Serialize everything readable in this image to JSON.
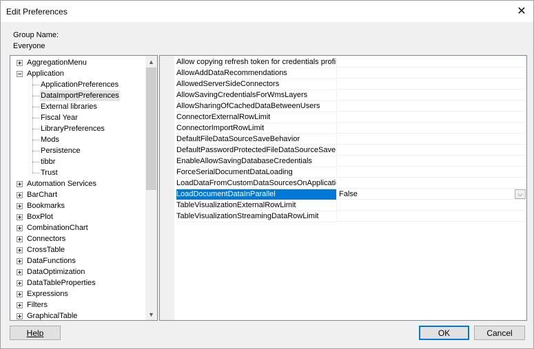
{
  "window": {
    "title": "Edit Preferences"
  },
  "group": {
    "label": "Group Name:",
    "value": "Everyone"
  },
  "tree": {
    "items": [
      {
        "label": "AggregationMenu",
        "level": 0,
        "expander": "plus"
      },
      {
        "label": "Application",
        "level": 0,
        "expander": "minus"
      },
      {
        "label": "ApplicationPreferences",
        "level": 1
      },
      {
        "label": "DataImportPreferences",
        "level": 1,
        "selected": true
      },
      {
        "label": "External libraries",
        "level": 1
      },
      {
        "label": "Fiscal Year",
        "level": 1
      },
      {
        "label": "LibraryPreferences",
        "level": 1
      },
      {
        "label": "Mods",
        "level": 1
      },
      {
        "label": "Persistence",
        "level": 1
      },
      {
        "label": "tibbr",
        "level": 1
      },
      {
        "label": "Trust",
        "level": 1
      },
      {
        "label": "Automation Services",
        "level": 0,
        "expander": "plus"
      },
      {
        "label": "BarChart",
        "level": 0,
        "expander": "plus"
      },
      {
        "label": "Bookmarks",
        "level": 0,
        "expander": "plus"
      },
      {
        "label": "BoxPlot",
        "level": 0,
        "expander": "plus"
      },
      {
        "label": "CombinationChart",
        "level": 0,
        "expander": "plus"
      },
      {
        "label": "Connectors",
        "level": 0,
        "expander": "plus"
      },
      {
        "label": "CrossTable",
        "level": 0,
        "expander": "plus"
      },
      {
        "label": "DataFunctions",
        "level": 0,
        "expander": "plus"
      },
      {
        "label": "DataOptimization",
        "level": 0,
        "expander": "plus"
      },
      {
        "label": "DataTableProperties",
        "level": 0,
        "expander": "plus"
      },
      {
        "label": "Expressions",
        "level": 0,
        "expander": "plus"
      },
      {
        "label": "Filters",
        "level": 0,
        "expander": "plus"
      },
      {
        "label": "GraphicalTable",
        "level": 0,
        "expander": "plus"
      }
    ]
  },
  "properties": [
    {
      "name": "Allow copying refresh token for credentials profile",
      "value": ""
    },
    {
      "name": "AllowAddDataRecommendations",
      "value": ""
    },
    {
      "name": "AllowedServerSideConnectors",
      "value": ""
    },
    {
      "name": "AllowSavingCredentialsForWmsLayers",
      "value": ""
    },
    {
      "name": "AllowSharingOfCachedDataBetweenUsers",
      "value": ""
    },
    {
      "name": "ConnectorExternalRowLimit",
      "value": ""
    },
    {
      "name": "ConnectorImportRowLimit",
      "value": ""
    },
    {
      "name": "DefaultFileDataSourceSaveBehavior",
      "value": ""
    },
    {
      "name": "DefaultPasswordProtectedFileDataSourceSaveBehavior",
      "value": ""
    },
    {
      "name": "EnableAllowSavingDatabaseCredentials",
      "value": ""
    },
    {
      "name": "ForceSerialDocumentDataLoading",
      "value": ""
    },
    {
      "name": "LoadDataFromCustomDataSourcesOnApplicationStart",
      "value": ""
    },
    {
      "name": "LoadDocumentDataInParallel",
      "value": "False",
      "selected": true
    },
    {
      "name": "TableVisualizationExternalRowLimit",
      "value": ""
    },
    {
      "name": "TableVisualizationStreamingDataRowLimit",
      "value": ""
    }
  ],
  "buttons": {
    "help": "Help",
    "ok": "OK",
    "cancel": "Cancel"
  },
  "icons": {
    "close": "close-icon",
    "scroll_up": "scroll-up-arrow-icon",
    "scroll_down": "scroll-down-arrow-icon",
    "dropdown": "chevron-down-icon"
  }
}
